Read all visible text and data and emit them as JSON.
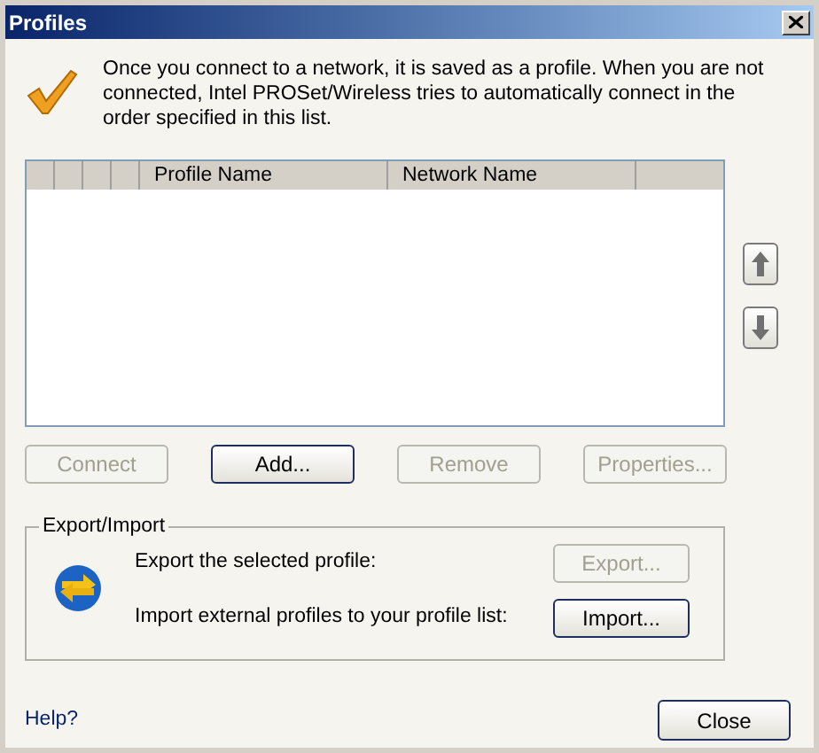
{
  "window": {
    "title": "Profiles"
  },
  "intro": "Once you connect to a network, it is saved as a profile. When you are not connected, Intel PROSet/Wireless tries to automatically connect in the order specified in this list.",
  "table": {
    "columns": [
      "Profile Name",
      "Network Name"
    ]
  },
  "buttons": [
    {
      "label": "Connect",
      "disabled": true
    },
    {
      "label": "Add...",
      "disabled": false
    },
    {
      "label": "Remove",
      "disabled": true
    },
    {
      "label": "Properties...",
      "disabled": true
    }
  ],
  "export_import": {
    "title": "Export/Import",
    "rows": [
      {
        "text": "Export the selected profile:",
        "button": "Export...",
        "disabled": true
      },
      {
        "text": "Import external profiles to your profile list:",
        "button": "Import...",
        "disabled": false
      }
    ]
  },
  "help": "Help?",
  "close": "Close"
}
